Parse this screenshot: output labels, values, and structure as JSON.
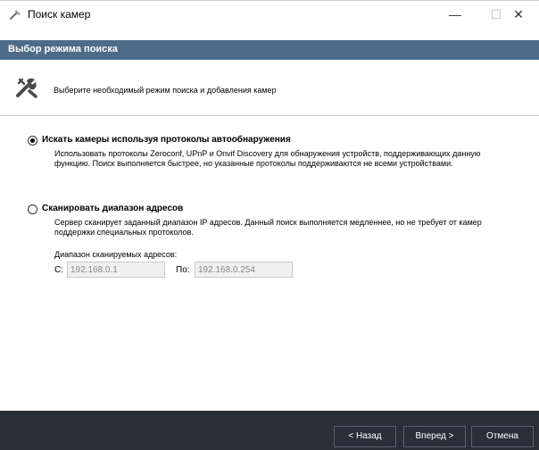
{
  "window": {
    "title": "Поиск камер",
    "minimize_glyph": "—",
    "maximize_glyph": "☐",
    "close_glyph": "✕"
  },
  "section_header": "Выбор режима поиска",
  "intro": {
    "text": "Выберите необходимый режим поиска и добавления камер",
    "icon": "tools-icon"
  },
  "options": [
    {
      "title": "Искать камеры используя протоколы автообнаружения",
      "description": "Использовать протоколы Zeroconf, UPnP и Onvif Discovery для обнаружения устройств, поддерживающих данную функцию. Поиск выполняется быстрее, но указанные протоколы поддерживаются не всеми устройствами.",
      "selected": true
    },
    {
      "title": "Сканировать диапазон адресов",
      "description": "Сервер сканирует заданный диапазон IP адресов. Данный поиск выполняется медленнее, но не требует от камер поддержки специальных протоколов.",
      "selected": false
    }
  ],
  "range": {
    "label": "Диапазон сканируемых адресов:",
    "from_label": "С:",
    "from_value": "192.168.0.1",
    "to_label": "По:",
    "to_value": "192.168.0.254"
  },
  "footer": {
    "back_label": "< Назад",
    "next_label": "Вперед >",
    "cancel_label": "Отмена"
  },
  "colors": {
    "header_bg": "#4d6c88",
    "footer_bg": "#2a2e38"
  }
}
